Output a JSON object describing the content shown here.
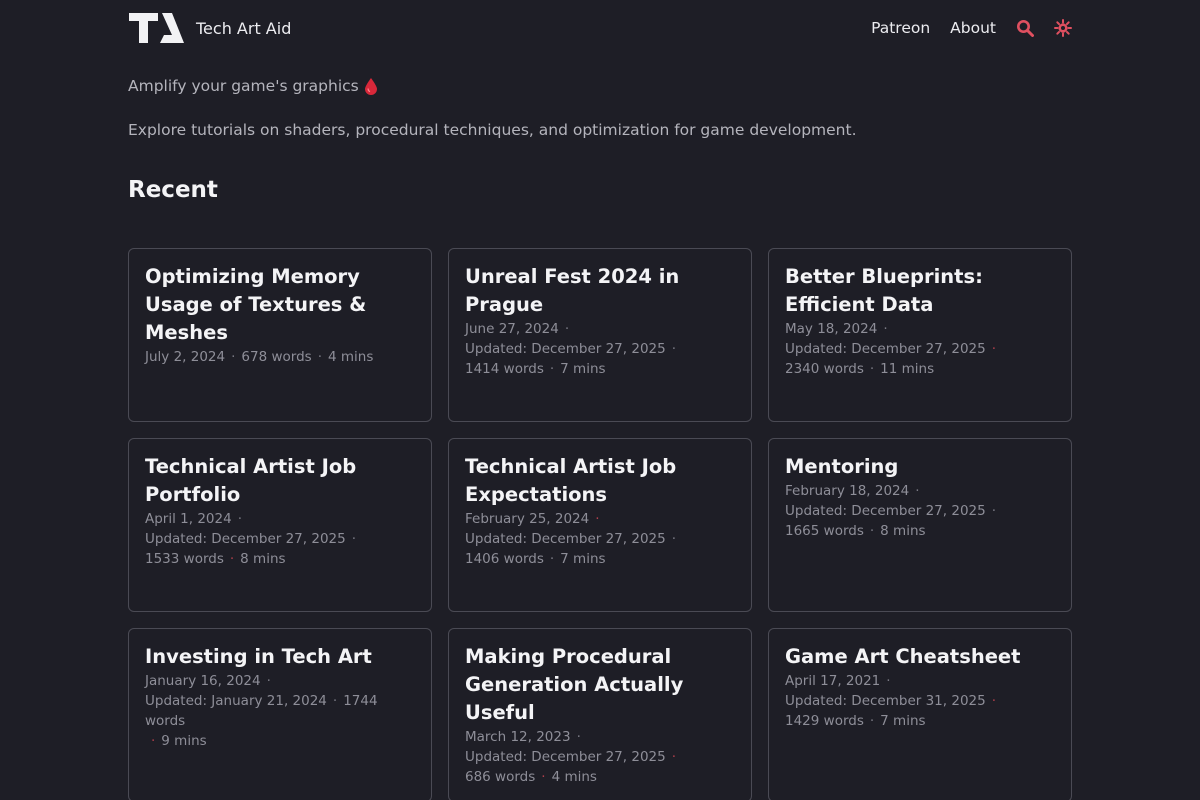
{
  "site": {
    "title": "Tech Art Aid",
    "accent_color": "#e05060"
  },
  "nav": {
    "links": [
      "Patreon",
      "About"
    ],
    "icons": [
      "search-icon",
      "theme-toggle-icon"
    ]
  },
  "intro": {
    "tagline": "Amplify your game's graphics",
    "description": "Explore tutorials on shaders, procedural techniques, and optimization for game development."
  },
  "recent": {
    "heading": "Recent",
    "posts": [
      {
        "title": "Optimizing Memory Usage of Textures & Meshes",
        "date": "July 2, 2024",
        "updated": "",
        "words": "678 words",
        "read": "4 mins"
      },
      {
        "title": "Unreal Fest 2024 in Prague",
        "date": "June 27, 2024",
        "updated": "Updated: December 27, 2025",
        "words": "1414 words",
        "read": "7 mins"
      },
      {
        "title": "Better Blueprints: Efficient Data",
        "date": "May 18, 2024",
        "updated": "Updated: December 27, 2025",
        "words": "2340 words",
        "read": "11 mins"
      },
      {
        "title": "Technical Artist Job Portfolio",
        "date": "April 1, 2024",
        "updated": "Updated: December 27, 2025",
        "words": "1533 words",
        "read": "8 mins"
      },
      {
        "title": "Technical Artist Job Expectations",
        "date": "February 25, 2024",
        "updated": "Updated: December 27, 2025",
        "words": "1406 words",
        "read": "7 mins"
      },
      {
        "title": "Mentoring",
        "date": "February 18, 2024",
        "updated": "Updated: December 27, 2025",
        "words": "1665 words",
        "read": "8 mins"
      },
      {
        "title": "Investing in Tech Art",
        "date": "January 16, 2024",
        "updated": "Updated: January 21, 2024",
        "words": "1744 words",
        "read": "9 mins"
      },
      {
        "title": "Making Procedural Generation Actually Useful",
        "date": "March 12, 2023",
        "updated": "Updated: December 27, 2025",
        "words": "686 words",
        "read": "4 mins"
      },
      {
        "title": "Game Art Cheatsheet",
        "date": "April 17, 2021",
        "updated": "Updated: December 31, 2025",
        "words": "1429 words",
        "read": "7 mins"
      }
    ]
  }
}
